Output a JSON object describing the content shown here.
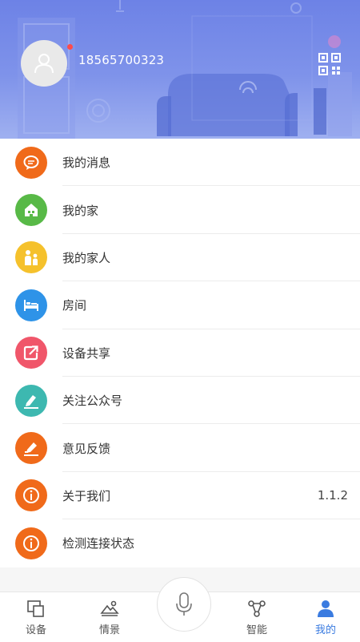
{
  "profile": {
    "phone": "18565700323",
    "avatar_icon": "user-avatar-icon",
    "qr_icon": "qr-code-icon"
  },
  "menu": [
    {
      "label": "我的消息",
      "icon": "message-icon",
      "color": "#f06a1a"
    },
    {
      "label": "我的家",
      "icon": "home-icon",
      "color": "#58b947"
    },
    {
      "label": "我的家人",
      "icon": "family-icon",
      "color": "#f5c12c"
    },
    {
      "label": "房间",
      "icon": "bed-icon",
      "color": "#2e93e8"
    },
    {
      "label": "设备共享",
      "icon": "share-icon",
      "color": "#f0566a"
    },
    {
      "label": "关注公众号",
      "icon": "sign-icon",
      "color": "#3db8b0"
    },
    {
      "label": "意见反馈",
      "icon": "feedback-icon",
      "color": "#f06a1a"
    },
    {
      "label": "关于我们",
      "icon": "info-icon",
      "color": "#f06a1a",
      "value": "1.1.2"
    },
    {
      "label": "检测连接状态",
      "icon": "info-icon",
      "color": "#f06a1a"
    }
  ],
  "tabs": [
    {
      "label": "设备",
      "icon": "device-icon",
      "active": false
    },
    {
      "label": "情景",
      "icon": "scene-icon",
      "active": false
    },
    {
      "label": "智能",
      "icon": "smart-icon",
      "active": false
    },
    {
      "label": "我的",
      "icon": "profile-icon",
      "active": true
    }
  ],
  "mic_icon": "microphone-icon",
  "colors": {
    "header": "#7b8fe9",
    "active_tab": "#3a7be0"
  }
}
